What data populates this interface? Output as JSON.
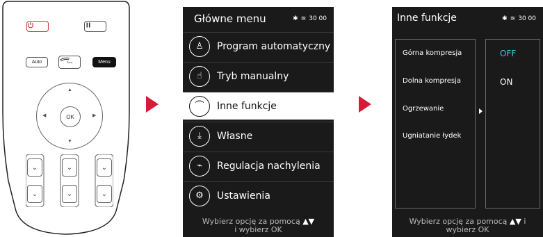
{
  "remote": {
    "buttons": {
      "auto": "Auto",
      "zero": "Zero",
      "menu": "Menu"
    },
    "dpad": {
      "ok": "OK"
    }
  },
  "screen1": {
    "title": "Główne menu",
    "status": {
      "timer": "30 00"
    },
    "items": [
      {
        "label": "Program automatyczny",
        "icon": "person-icon"
      },
      {
        "label": "Tryb manualny",
        "icon": "hand-icon"
      },
      {
        "label": "Inne funkcje",
        "icon": "massage-icon"
      },
      {
        "label": "Własne",
        "icon": "download-icon"
      },
      {
        "label": "Regulacja nachylenia",
        "icon": "recline-icon"
      },
      {
        "label": "Ustawienia",
        "icon": "gear-icon"
      }
    ],
    "footer_line1": "Wybierz opcję za pomocą",
    "footer_line2": "i wybierz OK"
  },
  "screen2": {
    "title": "Inne funkcje",
    "status": {
      "timer": "30 00"
    },
    "options": [
      "Górna kompresja",
      "Dolna kompresja",
      "Ogrzewanie",
      "Ugniatanie łydek"
    ],
    "values": [
      "OFF",
      "ON"
    ],
    "footer_line1": "Wybierz opcję za pomocą",
    "footer_line1b": "i",
    "footer_line2": "wybierz OK"
  },
  "colors": {
    "arrow": "#d7193a",
    "screen_bg": "#1a1a1a",
    "selected_value": "#4ec3e0"
  }
}
